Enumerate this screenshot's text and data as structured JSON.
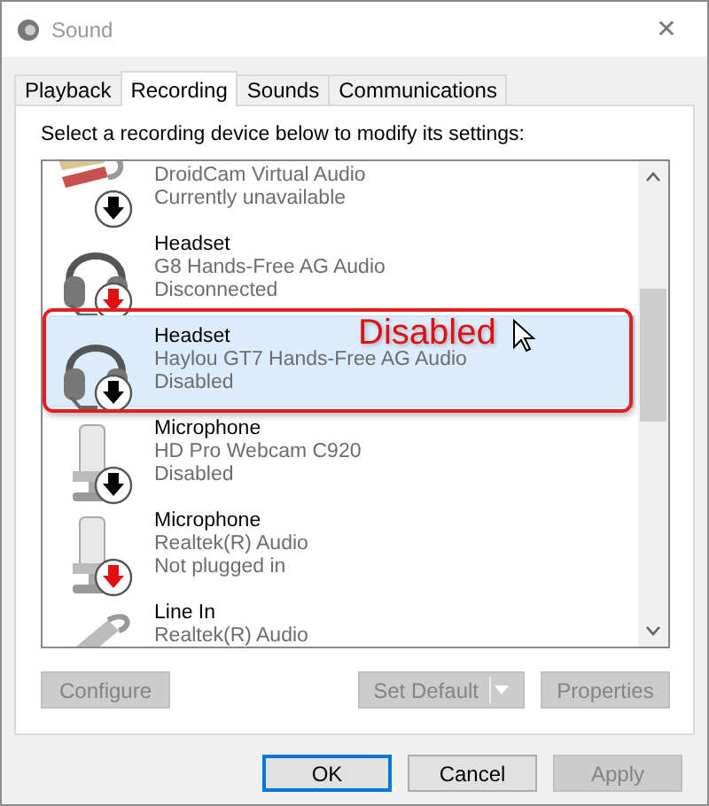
{
  "window": {
    "title": "Sound",
    "close": "✕"
  },
  "tabs": [
    {
      "label": "Playback",
      "selected": false
    },
    {
      "label": "Recording",
      "selected": true
    },
    {
      "label": "Sounds",
      "selected": false
    },
    {
      "label": "Communications",
      "selected": false
    }
  ],
  "instruction": "Select a recording device below to modify its settings:",
  "devices": [
    {
      "kind": "rca",
      "description": "DroidCam Virtual Audio",
      "status": "Currently unavailable",
      "color": "#000000",
      "selected": false
    },
    {
      "kind": "headset",
      "name": "Headset",
      "description": "G8 Hands-Free AG Audio",
      "status": "Disconnected",
      "color": "#e01010",
      "selected": false
    },
    {
      "kind": "headset",
      "name": "Headset",
      "description": "Haylou GT7 Hands-Free AG Audio",
      "status": "Disabled",
      "color": "#000000",
      "selected": true
    },
    {
      "kind": "microphone",
      "name": "Microphone",
      "description": "HD Pro Webcam C920",
      "status": "Disabled",
      "color": "#000000",
      "selected": false
    },
    {
      "kind": "microphone",
      "name": "Microphone",
      "description": "Realtek(R) Audio",
      "status": "Not plugged in",
      "color": "#e01010",
      "selected": false
    },
    {
      "kind": "linein",
      "name": "Line In",
      "description": "Realtek(R) Audio"
    }
  ],
  "annotation": {
    "label": "Disabled"
  },
  "panel_buttons": [
    {
      "label": "Configure",
      "disabled": true
    },
    {
      "label": "Set Default",
      "disabled": true,
      "split": true
    },
    {
      "label": "Properties",
      "disabled": true
    }
  ],
  "dialog_buttons": [
    {
      "label": "OK",
      "disabled": false,
      "default": true
    },
    {
      "label": "Cancel",
      "disabled": false,
      "default": false
    },
    {
      "label": "Apply",
      "disabled": true,
      "default": false
    }
  ]
}
